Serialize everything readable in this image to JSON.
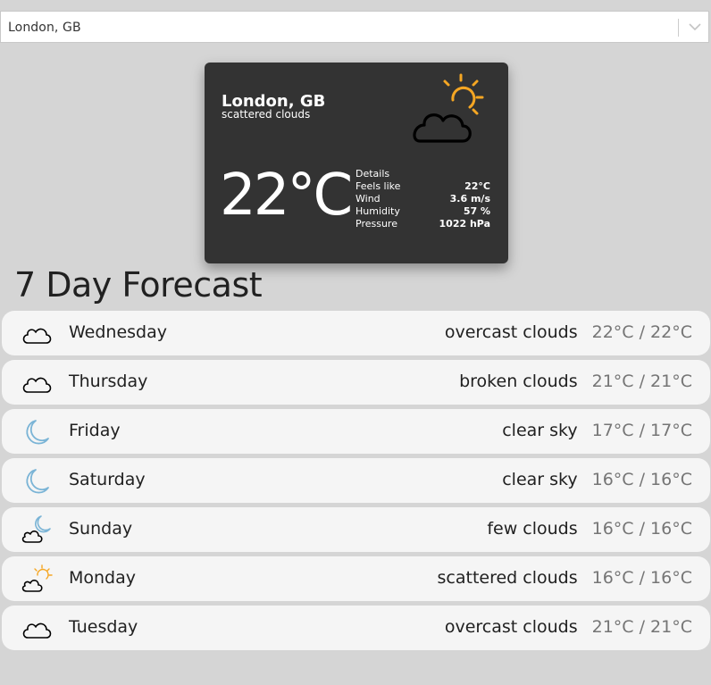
{
  "search": {
    "value": "London, GB"
  },
  "current": {
    "city": "London, GB",
    "description": "scattered clouds",
    "icon": "scattered-clouds-day-icon",
    "temperature": "22°C",
    "details_label": "Details",
    "details": [
      {
        "label": "Feels like",
        "value": "22°C"
      },
      {
        "label": "Wind",
        "value": "3.6 m/s"
      },
      {
        "label": "Humidity",
        "value": "57 %"
      },
      {
        "label": "Pressure",
        "value": "1022 hPa"
      }
    ]
  },
  "forecast": {
    "title": "7 Day Forecast",
    "days": [
      {
        "day": "Wednesday",
        "description": "overcast clouds",
        "temp": "22°C / 22°C",
        "icon": "cloud-icon"
      },
      {
        "day": "Thursday",
        "description": "broken clouds",
        "temp": "21°C / 21°C",
        "icon": "cloud-icon"
      },
      {
        "day": "Friday",
        "description": "clear sky",
        "temp": "17°C / 17°C",
        "icon": "moon-icon"
      },
      {
        "day": "Saturday",
        "description": "clear sky",
        "temp": "16°C / 16°C",
        "icon": "moon-icon"
      },
      {
        "day": "Sunday",
        "description": "few clouds",
        "temp": "16°C / 16°C",
        "icon": "cloud-moon-icon"
      },
      {
        "day": "Monday",
        "description": "scattered clouds",
        "temp": "16°C / 16°C",
        "icon": "cloud-sun-icon"
      },
      {
        "day": "Tuesday",
        "description": "overcast clouds",
        "temp": "21°C / 21°C",
        "icon": "cloud-icon"
      }
    ]
  },
  "colors": {
    "background": "#d5d5d5",
    "card": "#333333",
    "row": "#f5f5f5",
    "sun": "#f5a623",
    "moon": "#7ab4d6"
  }
}
